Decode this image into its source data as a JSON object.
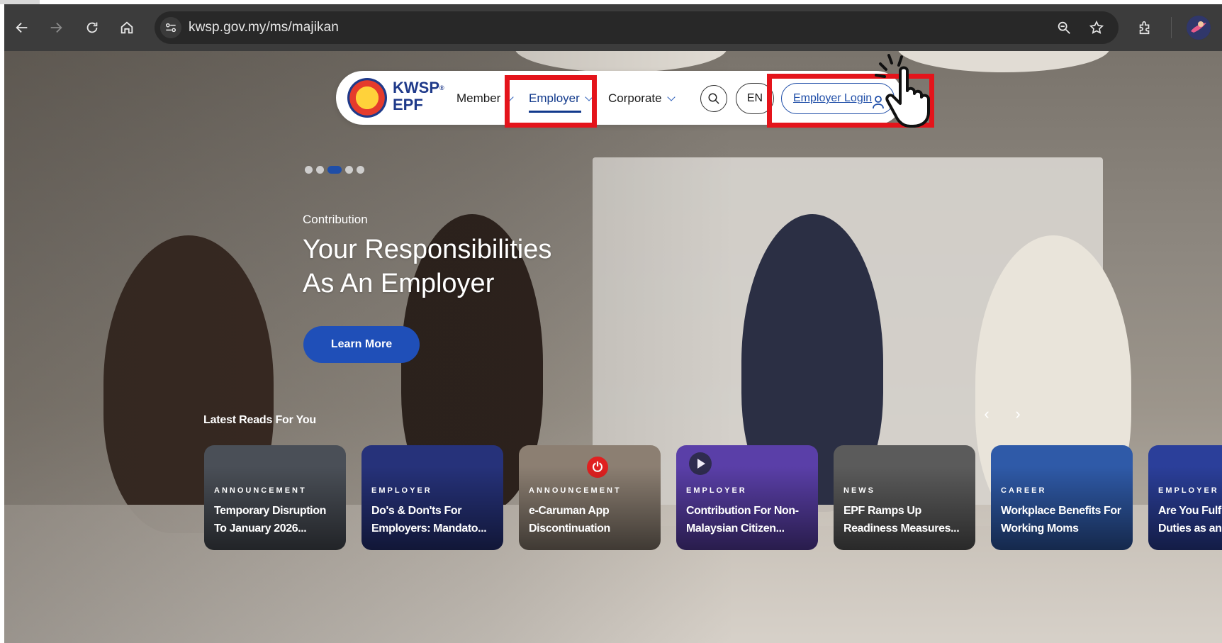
{
  "browser": {
    "url": "kwsp.gov.my/ms/majikan",
    "icons": [
      "back-arrow-icon",
      "forward-arrow-icon",
      "reload-icon",
      "home-icon",
      "site-settings-icon",
      "zoom-icon",
      "bookmark-star-icon",
      "extensions-icon",
      "profile-avatar"
    ]
  },
  "navbar": {
    "logo_line1": "KWSP",
    "logo_line2": "EPF",
    "logo_sup": "®",
    "member": "Member",
    "employer": "Employer",
    "corporate": "Corporate",
    "lang": "EN",
    "login": "Employer Login"
  },
  "hero": {
    "eyebrow": "Contribution",
    "headline_line1": "Your Responsibilities",
    "headline_line2": "As An Employer",
    "cta": "Learn More",
    "slides_total": 5,
    "slide_active": 3
  },
  "latest": {
    "title": "Latest Reads For You",
    "cards": [
      {
        "tag": "ANNOUNCEMENT",
        "title_line1": "Temporary Disruption",
        "title_line2": "To January 2026...",
        "color": "#4a4f57"
      },
      {
        "tag": "EMPLOYER",
        "title_line1": "Do's & Don'ts For",
        "title_line2": "Employers: Mandato...",
        "color": "#26327a"
      },
      {
        "tag": "ANNOUNCEMENT",
        "title_line1": "e-Caruman App",
        "title_line2": "Discontinuation",
        "color": "#8c7f72"
      },
      {
        "tag": "EMPLOYER",
        "title_line1": "Contribution For Non-",
        "title_line2": "Malaysian Citizen...",
        "color": "#5a3fa8"
      },
      {
        "tag": "NEWS",
        "title_line1": "EPF Ramps Up",
        "title_line2": "Readiness Measures...",
        "color": "#5b5b5b"
      },
      {
        "tag": "CAREER",
        "title_line1": "Workplace Benefits For",
        "title_line2": "Working Moms",
        "color": "#2f5aa8"
      },
      {
        "tag": "EMPLOYER",
        "title_line1": "Are You Fulfil",
        "title_line2": "Duties as an...",
        "color": "#2b3f9a"
      }
    ]
  },
  "colors": {
    "brand_blue": "#1f4fb8",
    "highlight_red": "#e4141b",
    "chrome_dark": "#3c3c3c"
  }
}
